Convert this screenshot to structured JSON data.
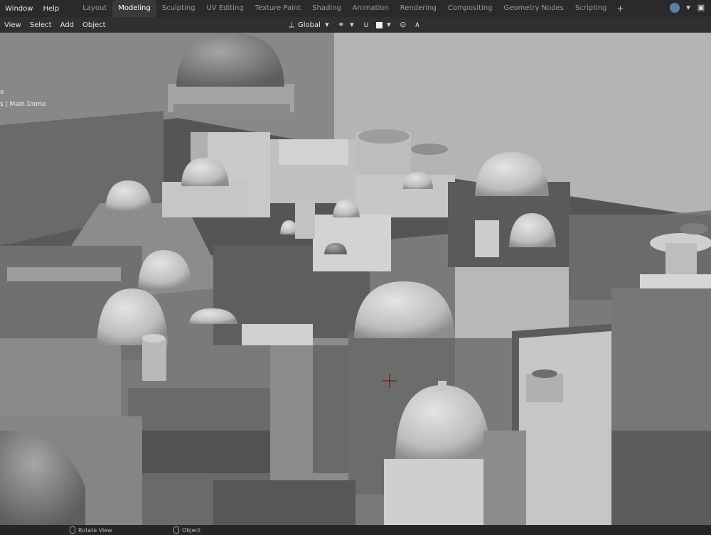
{
  "topbar": {
    "menus": [
      "Window",
      "Help"
    ],
    "tabs": [
      {
        "label": "Layout",
        "active": false
      },
      {
        "label": "Modeling",
        "active": true
      },
      {
        "label": "Sculpting",
        "active": false
      },
      {
        "label": "UV Editing",
        "active": false
      },
      {
        "label": "Texture Paint",
        "active": false
      },
      {
        "label": "Shading",
        "active": false
      },
      {
        "label": "Animation",
        "active": false
      },
      {
        "label": "Rendering",
        "active": false
      },
      {
        "label": "Compositing",
        "active": false
      },
      {
        "label": "Geometry Nodes",
        "active": false
      },
      {
        "label": "Scripting",
        "active": false
      }
    ],
    "add_tab": "+"
  },
  "header": {
    "menus": [
      "View",
      "Select",
      "Add",
      "Object"
    ],
    "transform_orientation": "Global"
  },
  "viewport": {
    "overlay_line1": "e",
    "overlay_line2": "s | Main Dome"
  },
  "statusbar": {
    "rotate_view": "Rotate View",
    "object": "Object"
  },
  "colors": {
    "accent": "#5d7fa8",
    "active_tab": "#3a3a3a",
    "cursor_red": "#d9473a"
  }
}
